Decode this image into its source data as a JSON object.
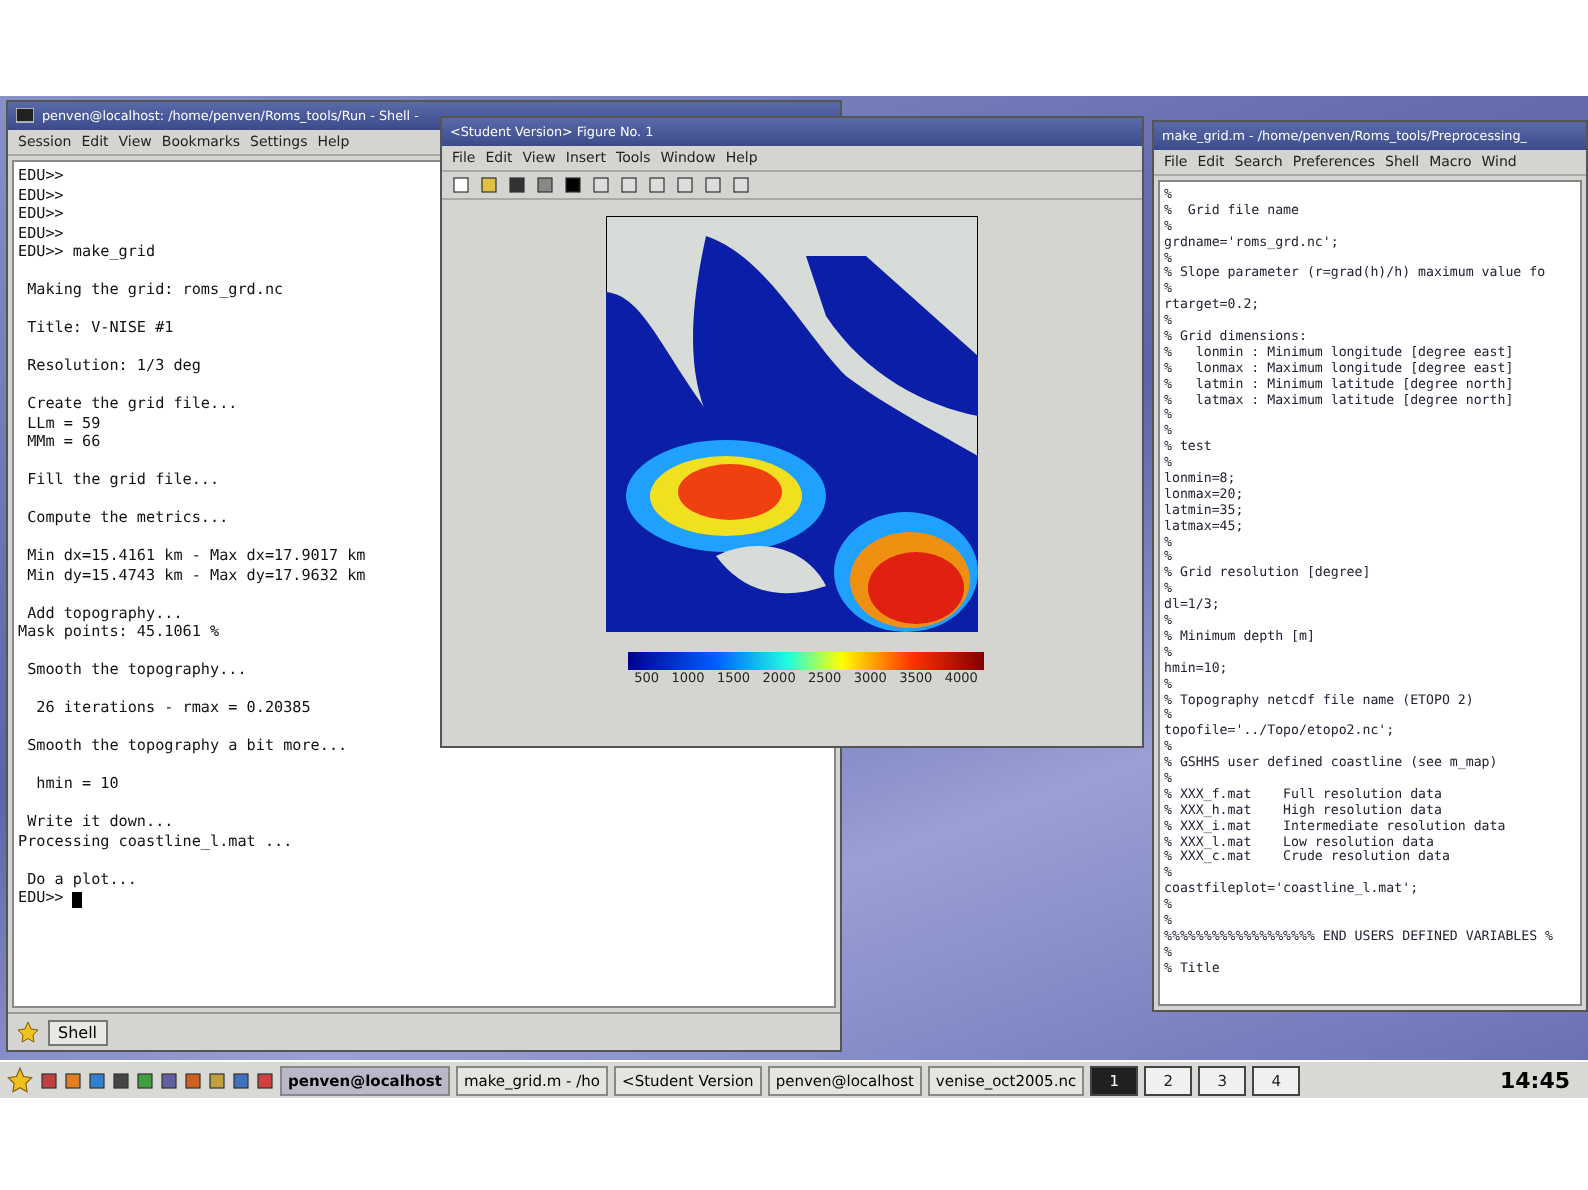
{
  "terminal": {
    "title": "penven@localhost: /home/penven/Roms_tools/Run - Shell -",
    "menu": [
      "Session",
      "Edit",
      "View",
      "Bookmarks",
      "Settings",
      "Help"
    ],
    "lines": [
      {
        "text": "EDU>>",
        "gap": false
      },
      {
        "text": "EDU>>",
        "gap": false
      },
      {
        "text": "EDU>>",
        "gap": false
      },
      {
        "text": "EDU>>",
        "gap": false
      },
      {
        "text": "EDU>> make_grid",
        "gap": false
      },
      {
        "text": " Making the grid: roms_grd.nc",
        "gap": true
      },
      {
        "text": " Title: V-NISE #1",
        "gap": true
      },
      {
        "text": " Resolution: 1/3 deg",
        "gap": true
      },
      {
        "text": " Create the grid file...",
        "gap": true
      },
      {
        "text": " LLm = 59",
        "gap": false
      },
      {
        "text": " MMm = 66",
        "gap": false
      },
      {
        "text": " Fill the grid file...",
        "gap": true
      },
      {
        "text": " Compute the metrics...",
        "gap": true
      },
      {
        "text": " Min dx=15.4161 km - Max dx=17.9017 km",
        "gap": true
      },
      {
        "text": " Min dy=15.4743 km - Max dy=17.9632 km",
        "gap": false
      },
      {
        "text": " Add topography...",
        "gap": true
      },
      {
        "text": "Mask points: 45.1061 %",
        "gap": false
      },
      {
        "text": " Smooth the topography...",
        "gap": true
      },
      {
        "text": "  26 iterations - rmax = 0.20385",
        "gap": true
      },
      {
        "text": " Smooth the topography a bit more...",
        "gap": true
      },
      {
        "text": "  hmin = 10",
        "gap": true
      },
      {
        "text": " Write it down...",
        "gap": true
      },
      {
        "text": "Processing coastline_l.mat ...",
        "gap": false
      },
      {
        "text": " Do a plot...",
        "gap": true
      },
      {
        "text": "EDU>>",
        "gap": false
      }
    ],
    "cursor": true,
    "tabs": [
      {
        "label": "Shell",
        "selected": true
      }
    ]
  },
  "figure": {
    "title": "<Student Version> Figure No. 1",
    "menu": [
      "File",
      "Edit",
      "View",
      "Insert",
      "Tools",
      "Window",
      "Help"
    ],
    "colorbar_labels": [
      "500",
      "1000",
      "1500",
      "2000",
      "2500",
      "3000",
      "3500",
      "4000"
    ]
  },
  "editor": {
    "title": "make_grid.m - /home/penven/Roms_tools/Preprocessing_",
    "menu": [
      "File",
      "Edit",
      "Search",
      "Preferences",
      "Shell",
      "Macro",
      "Wind"
    ],
    "lines": [
      "%",
      "%  Grid file name",
      "%",
      "grdname='roms_grd.nc';",
      "%",
      "% Slope parameter (r=grad(h)/h) maximum value fo",
      "%",
      "rtarget=0.2;",
      "%",
      "% Grid dimensions:",
      "%   lonmin : Minimum longitude [degree east]",
      "%   lonmax : Maximum longitude [degree east]",
      "%   latmin : Minimum latitude [degree north]",
      "%   latmax : Maximum latitude [degree north]",
      "%",
      "%",
      "% test",
      "%",
      "lonmin=8;",
      "lonmax=20;",
      "latmin=35;",
      "latmax=45;",
      "%",
      "%",
      "% Grid resolution [degree]",
      "%",
      "dl=1/3;",
      "%",
      "% Minimum depth [m]",
      "%",
      "hmin=10;",
      "%",
      "% Topography netcdf file name (ETOPO 2)",
      "%",
      "topofile='../Topo/etopo2.nc';",
      "%",
      "% GSHHS user defined coastline (see m_map)",
      "%",
      "% XXX_f.mat    Full resolution data",
      "% XXX_h.mat    High resolution data",
      "% XXX_i.mat    Intermediate resolution data",
      "% XXX_l.mat    Low resolution data",
      "% XXX_c.mat    Crude resolution data",
      "%",
      "coastfileplot='coastline_l.mat';",
      "%",
      "%",
      "%%%%%%%%%%%%%%%%%%% END USERS DEFINED VARIABLES %",
      "%",
      "% Title"
    ]
  },
  "taskbar": {
    "tasks": [
      {
        "label": "penven@localhost",
        "selected": true
      },
      {
        "label": "make_grid.m - /ho",
        "selected": false
      },
      {
        "label": "<Student Version",
        "selected": false
      },
      {
        "label": "penven@localhost",
        "selected": false
      },
      {
        "label": "venise_oct2005.nc",
        "selected": false
      }
    ],
    "desktops": [
      {
        "label": "1",
        "selected": true
      },
      {
        "label": "2",
        "selected": false
      },
      {
        "label": "3",
        "selected": false
      },
      {
        "label": "4",
        "selected": false
      }
    ],
    "clock": "14:45"
  }
}
